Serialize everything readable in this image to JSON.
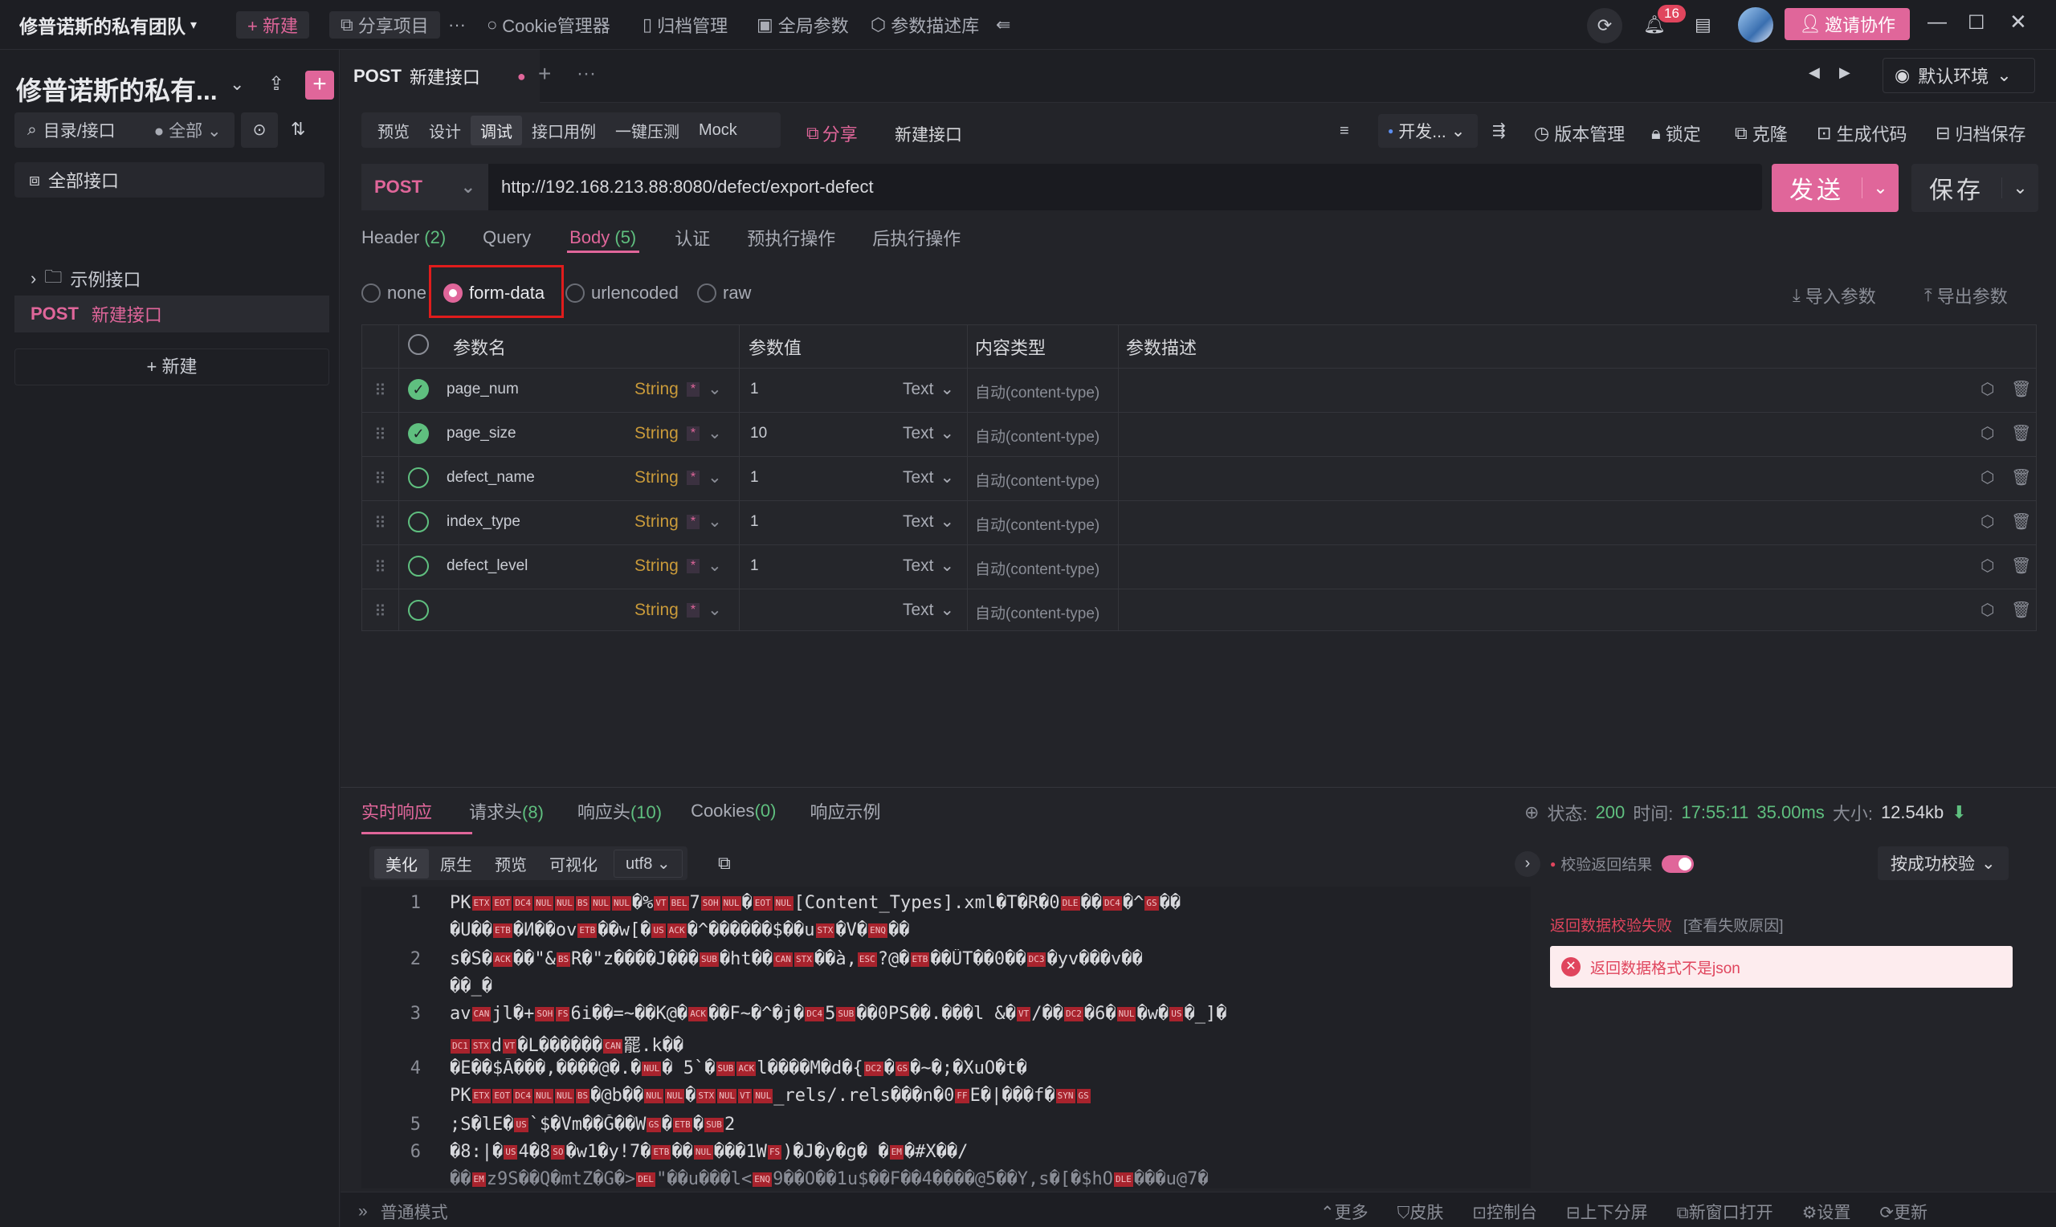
{
  "topbar": {
    "team": "修普诺斯的私有团队",
    "new_label": "+ 新建",
    "share_project": "分享项目",
    "more": "···",
    "cookie": "Cookie管理器",
    "archive": "归档管理",
    "global_params": "全局参数",
    "param_desc": "参数描述库",
    "notif_count": "16",
    "invite": "邀请协作"
  },
  "sidebar": {
    "project_title": "修普诺斯的私有...",
    "search_placeholder": "目录/接口",
    "filter": "全部",
    "all_apis": "全部接口",
    "folder": "示例接口",
    "api_method": "POST",
    "api_name": "新建接口",
    "new_btn": "+ 新建"
  },
  "tab": {
    "method": "POST",
    "name": "新建接口",
    "env": "默认环境"
  },
  "subnav": {
    "items": [
      "预览",
      "设计",
      "调试",
      "接口用例",
      "一键压测",
      "Mock"
    ],
    "active": "调试",
    "share": "分享",
    "api_name": "新建接口",
    "dev": "开发...",
    "version": "版本管理",
    "lock": "锁定",
    "clone": "克隆",
    "gencode": "生成代码",
    "archive_save": "归档保存"
  },
  "request": {
    "method": "POST",
    "url": "http://192.168.213.88:8080/defect/export-defect",
    "send": "发送",
    "save": "保存"
  },
  "req_tabs": {
    "header": "Header",
    "header_count": "(2)",
    "query": "Query",
    "body": "Body",
    "body_count": "(5)",
    "auth": "认证",
    "pre": "预执行操作",
    "post": "后执行操作"
  },
  "body_types": {
    "none": "none",
    "form_data": "form-data",
    "urlencoded": "urlencoded",
    "raw": "raw",
    "import": "导入参数",
    "export": "导出参数"
  },
  "table": {
    "headers": [
      "参数名",
      "参数值",
      "内容类型",
      "参数描述"
    ],
    "rows": [
      {
        "name": "page_num",
        "type": "String",
        "value": "1",
        "kind": "Text",
        "ctype": "自动(content-type)",
        "checked": true
      },
      {
        "name": "page_size",
        "type": "String",
        "value": "10",
        "kind": "Text",
        "ctype": "自动(content-type)",
        "checked": true
      },
      {
        "name": "defect_name",
        "type": "String",
        "value": "1",
        "kind": "Text",
        "ctype": "自动(content-type)",
        "checked": false
      },
      {
        "name": "index_type",
        "type": "String",
        "value": "1",
        "kind": "Text",
        "ctype": "自动(content-type)",
        "checked": false
      },
      {
        "name": "defect_level",
        "type": "String",
        "value": "1",
        "kind": "Text",
        "ctype": "自动(content-type)",
        "checked": false
      },
      {
        "name": "",
        "type": "String",
        "value": "",
        "kind": "Text",
        "ctype": "自动(content-type)",
        "checked": false
      }
    ],
    "required_mark": "*"
  },
  "response": {
    "tabs": [
      "实时响应",
      "请求头",
      "响应头",
      "Cookies",
      "响应示例"
    ],
    "req_head_count": "(8)",
    "resp_head_count": "(10)",
    "cookies_count": "(0)",
    "status_label": "状态:",
    "status": "200",
    "time_label": "时间:",
    "time": "17:55:11",
    "duration": "35.00ms",
    "size_label": "大小:",
    "size": "12.54kb",
    "view_modes": [
      "美化",
      "原生",
      "预览",
      "可视化"
    ],
    "encoding": "utf8",
    "validate_label": "校验返回结果",
    "validate_mode": "按成功校验",
    "fail_title": "返回数据校验失败",
    "fail_link": "[查看失败原因]",
    "error_msg": "返回数据格式不是json",
    "line_numbers": [
      "1",
      "",
      "2",
      "",
      "3",
      "",
      "4",
      "",
      "5",
      "6"
    ]
  },
  "statusbar": {
    "mode": "普通模式",
    "more": "更多",
    "skin": "皮肤",
    "console": "控制台",
    "split": "上下分屏",
    "new_window": "新窗口打开",
    "settings": "设置",
    "update": "更新"
  },
  "colors": {
    "accent": "#e0669a",
    "green": "#5fbf7f",
    "bg": "#232429"
  }
}
